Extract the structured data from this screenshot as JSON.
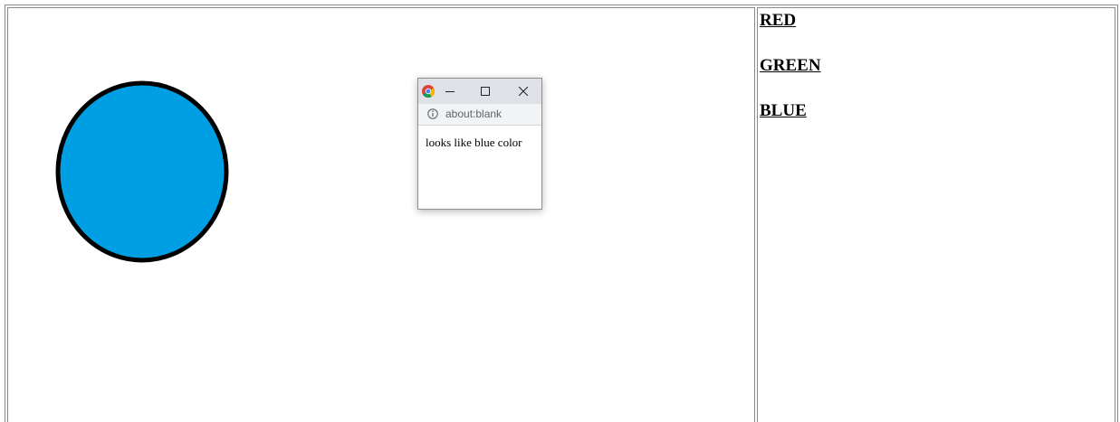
{
  "links": {
    "red": "RED",
    "green": "GREEN",
    "blue": "BLUE"
  },
  "circle": {
    "fill": "#009fe3",
    "stroke": "#000000"
  },
  "popup": {
    "address": "about:blank",
    "message": "looks like blue color",
    "icons": {
      "browser": "chrome-icon",
      "minimize": "minimize-icon",
      "maximize": "maximize-icon",
      "close": "close-icon",
      "info": "info-icon"
    }
  }
}
